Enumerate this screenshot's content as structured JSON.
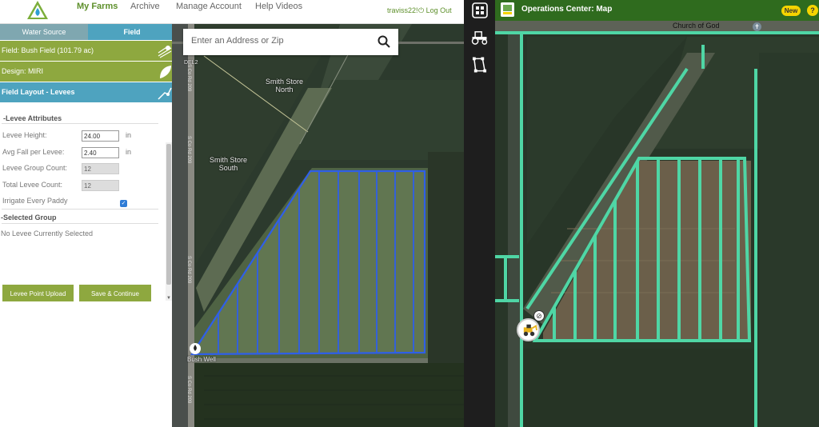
{
  "left_app": {
    "nav": {
      "items": [
        "My Farms",
        "Archive",
        "Manage Account",
        "Help Videos"
      ],
      "active": "My Farms",
      "user": "traviss22!",
      "logout": "Log Out"
    },
    "tabs": [
      "Water Source",
      "Field"
    ],
    "active_tab": "Field",
    "field_bar": "Field: Bush Field (101.79 ac)",
    "design_bar": "Design: MIRI",
    "layout_bar": "Field Layout - Levees",
    "levee_attributes": {
      "heading": "-Levee Attributes",
      "levee_height_label": "Levee Height:",
      "levee_height": "24.00",
      "levee_height_unit": "in",
      "avg_fall_label": "Avg Fall per Levee:",
      "avg_fall": "2.40",
      "avg_fall_unit": "in",
      "group_count_label": "Levee Group Count:",
      "group_count": "12",
      "total_count_label": "Total Levee Count:",
      "total_count": "12",
      "irrigate_label": "Irrigate Every Paddy",
      "irrigate_checked": true
    },
    "selected_group": {
      "heading": "-Selected Group",
      "empty_text": "No Levee Currently Selected"
    },
    "buttons": {
      "upload": "Levee Point Upload",
      "save": "Save & Continue"
    },
    "map": {
      "search_placeholder": "Enter an Address or Zip",
      "labels": {
        "smith_north": [
          "Smith Store",
          "North"
        ],
        "smith_south": [
          "Smith Store",
          "South"
        ],
        "well": "Bush Well",
        "del": "DEL2",
        "road": "S Co Rd 209"
      },
      "levee_color": "#2f5fe8"
    }
  },
  "right_app": {
    "title": "Operations Center: Map",
    "badge": "New",
    "help": "?",
    "map_label": "Church of God",
    "boundary_color": "#4fd6a5"
  }
}
